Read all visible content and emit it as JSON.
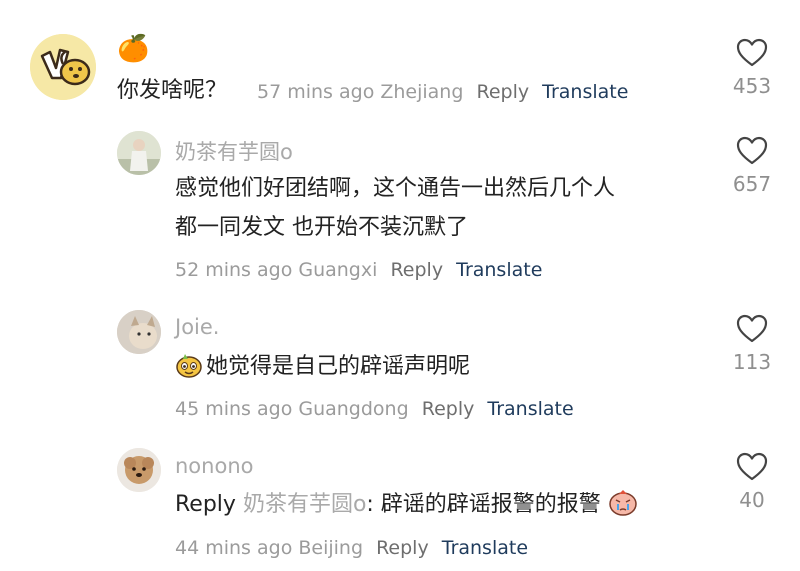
{
  "comments": [
    {
      "username_emoji": "🍊",
      "text": "你发啥呢？",
      "time": "57 mins ago",
      "location": "Zhejiang",
      "reply_label": "Reply",
      "translate_label": "Translate",
      "likes": "453"
    },
    {
      "username": "奶茶有芋圆o",
      "text_line1": "感觉他们好团结啊，这个通告一出然后几个人",
      "text_line2": "都一同发文 也开始不装沉默了",
      "time": "52 mins ago",
      "location": "Guangxi",
      "reply_label": "Reply",
      "translate_label": "Translate",
      "likes": "657"
    },
    {
      "username": "Joie.",
      "text": "她觉得是自己的辟谣声明呢",
      "time": "45 mins ago",
      "location": "Guangdong",
      "reply_label": "Reply",
      "translate_label": "Translate",
      "likes": "113"
    },
    {
      "username": "nonono",
      "reply_prefix": "Reply",
      "reply_to": "奶茶有芋圆o",
      "text": ": 辟谣的辟谣报警的报警",
      "time": "44 mins ago",
      "location": "Beijing",
      "reply_label": "Reply",
      "translate_label": "Translate",
      "likes": "40"
    }
  ]
}
